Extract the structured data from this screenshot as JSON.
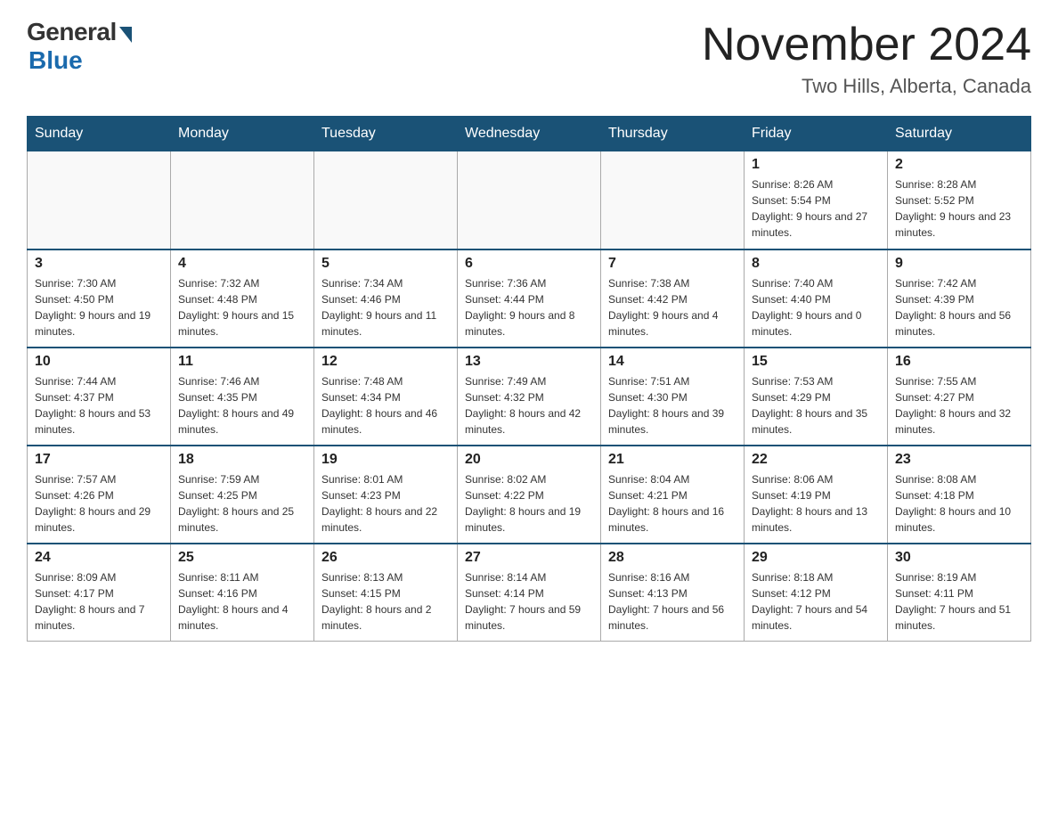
{
  "logo": {
    "general": "General",
    "blue": "Blue"
  },
  "title": "November 2024",
  "subtitle": "Two Hills, Alberta, Canada",
  "days_of_week": [
    "Sunday",
    "Monday",
    "Tuesday",
    "Wednesday",
    "Thursday",
    "Friday",
    "Saturday"
  ],
  "weeks": [
    [
      {
        "day": "",
        "info": ""
      },
      {
        "day": "",
        "info": ""
      },
      {
        "day": "",
        "info": ""
      },
      {
        "day": "",
        "info": ""
      },
      {
        "day": "",
        "info": ""
      },
      {
        "day": "1",
        "info": "Sunrise: 8:26 AM\nSunset: 5:54 PM\nDaylight: 9 hours and 27 minutes."
      },
      {
        "day": "2",
        "info": "Sunrise: 8:28 AM\nSunset: 5:52 PM\nDaylight: 9 hours and 23 minutes."
      }
    ],
    [
      {
        "day": "3",
        "info": "Sunrise: 7:30 AM\nSunset: 4:50 PM\nDaylight: 9 hours and 19 minutes."
      },
      {
        "day": "4",
        "info": "Sunrise: 7:32 AM\nSunset: 4:48 PM\nDaylight: 9 hours and 15 minutes."
      },
      {
        "day": "5",
        "info": "Sunrise: 7:34 AM\nSunset: 4:46 PM\nDaylight: 9 hours and 11 minutes."
      },
      {
        "day": "6",
        "info": "Sunrise: 7:36 AM\nSunset: 4:44 PM\nDaylight: 9 hours and 8 minutes."
      },
      {
        "day": "7",
        "info": "Sunrise: 7:38 AM\nSunset: 4:42 PM\nDaylight: 9 hours and 4 minutes."
      },
      {
        "day": "8",
        "info": "Sunrise: 7:40 AM\nSunset: 4:40 PM\nDaylight: 9 hours and 0 minutes."
      },
      {
        "day": "9",
        "info": "Sunrise: 7:42 AM\nSunset: 4:39 PM\nDaylight: 8 hours and 56 minutes."
      }
    ],
    [
      {
        "day": "10",
        "info": "Sunrise: 7:44 AM\nSunset: 4:37 PM\nDaylight: 8 hours and 53 minutes."
      },
      {
        "day": "11",
        "info": "Sunrise: 7:46 AM\nSunset: 4:35 PM\nDaylight: 8 hours and 49 minutes."
      },
      {
        "day": "12",
        "info": "Sunrise: 7:48 AM\nSunset: 4:34 PM\nDaylight: 8 hours and 46 minutes."
      },
      {
        "day": "13",
        "info": "Sunrise: 7:49 AM\nSunset: 4:32 PM\nDaylight: 8 hours and 42 minutes."
      },
      {
        "day": "14",
        "info": "Sunrise: 7:51 AM\nSunset: 4:30 PM\nDaylight: 8 hours and 39 minutes."
      },
      {
        "day": "15",
        "info": "Sunrise: 7:53 AM\nSunset: 4:29 PM\nDaylight: 8 hours and 35 minutes."
      },
      {
        "day": "16",
        "info": "Sunrise: 7:55 AM\nSunset: 4:27 PM\nDaylight: 8 hours and 32 minutes."
      }
    ],
    [
      {
        "day": "17",
        "info": "Sunrise: 7:57 AM\nSunset: 4:26 PM\nDaylight: 8 hours and 29 minutes."
      },
      {
        "day": "18",
        "info": "Sunrise: 7:59 AM\nSunset: 4:25 PM\nDaylight: 8 hours and 25 minutes."
      },
      {
        "day": "19",
        "info": "Sunrise: 8:01 AM\nSunset: 4:23 PM\nDaylight: 8 hours and 22 minutes."
      },
      {
        "day": "20",
        "info": "Sunrise: 8:02 AM\nSunset: 4:22 PM\nDaylight: 8 hours and 19 minutes."
      },
      {
        "day": "21",
        "info": "Sunrise: 8:04 AM\nSunset: 4:21 PM\nDaylight: 8 hours and 16 minutes."
      },
      {
        "day": "22",
        "info": "Sunrise: 8:06 AM\nSunset: 4:19 PM\nDaylight: 8 hours and 13 minutes."
      },
      {
        "day": "23",
        "info": "Sunrise: 8:08 AM\nSunset: 4:18 PM\nDaylight: 8 hours and 10 minutes."
      }
    ],
    [
      {
        "day": "24",
        "info": "Sunrise: 8:09 AM\nSunset: 4:17 PM\nDaylight: 8 hours and 7 minutes."
      },
      {
        "day": "25",
        "info": "Sunrise: 8:11 AM\nSunset: 4:16 PM\nDaylight: 8 hours and 4 minutes."
      },
      {
        "day": "26",
        "info": "Sunrise: 8:13 AM\nSunset: 4:15 PM\nDaylight: 8 hours and 2 minutes."
      },
      {
        "day": "27",
        "info": "Sunrise: 8:14 AM\nSunset: 4:14 PM\nDaylight: 7 hours and 59 minutes."
      },
      {
        "day": "28",
        "info": "Sunrise: 8:16 AM\nSunset: 4:13 PM\nDaylight: 7 hours and 56 minutes."
      },
      {
        "day": "29",
        "info": "Sunrise: 8:18 AM\nSunset: 4:12 PM\nDaylight: 7 hours and 54 minutes."
      },
      {
        "day": "30",
        "info": "Sunrise: 8:19 AM\nSunset: 4:11 PM\nDaylight: 7 hours and 51 minutes."
      }
    ]
  ]
}
